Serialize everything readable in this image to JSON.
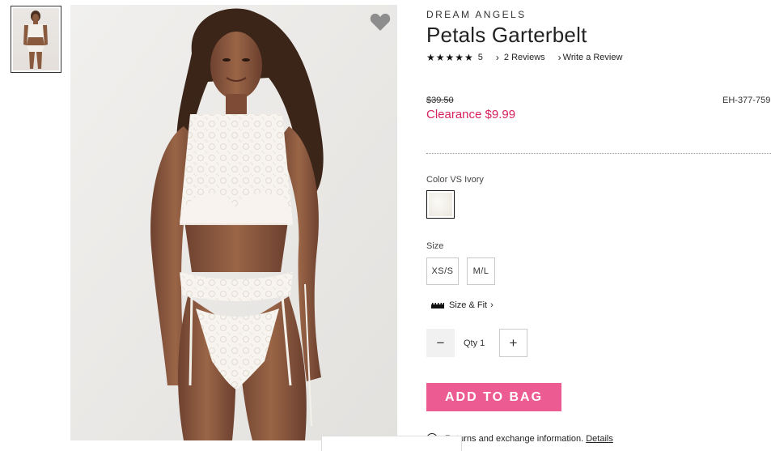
{
  "product": {
    "brand": "DREAM ANGELS",
    "title": "Petals Garterbelt",
    "stars": "★★★★★",
    "rating": "5",
    "reviews_link": "2 Reviews",
    "write_review_link": "Write a Review",
    "original_price": "$39.50",
    "sale_price": "Clearance $9.99",
    "sku": "EH-377-759"
  },
  "color": {
    "label": "Color VS Ivory",
    "swatch_hex": "#f3f1ec"
  },
  "size": {
    "label": "Size",
    "options": [
      "XS/S",
      "M/L"
    ]
  },
  "size_fit_link": "Size & Fit",
  "quantity": {
    "label": "Qty 1",
    "minus": "−",
    "plus": "+"
  },
  "add_to_bag": "ADD TO BAG",
  "returns": {
    "text": "Returns and exchange information.",
    "link": "Details"
  },
  "icons": {
    "wishlist": "heart-icon",
    "chevron": "chevron-right-icon",
    "ruler": "ruler-icon",
    "returns": "circle-icon"
  },
  "colors": {
    "sale": "#d6215e",
    "add_to_bag_bg": "#ec5b92"
  }
}
